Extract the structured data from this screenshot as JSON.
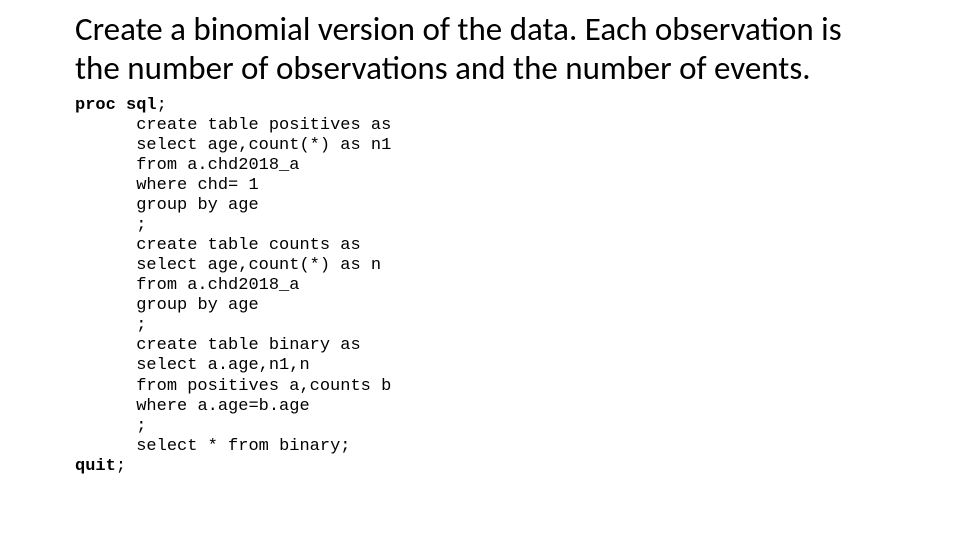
{
  "title": "Create a binomial version of the data.  Each observation is the number of observations and the number of events.",
  "code": {
    "t0": "proc",
    "t1": "sql",
    "t2": ";",
    "t3": "create",
    "t4": "table",
    "t5": "positives",
    "t6": "as",
    "t7": "select",
    "t8": "age,count(*)",
    "t9": "as",
    "t10": "n1",
    "t11": "from",
    "t12": "a.chd2018_a",
    "t13": "where",
    "t14": "chd=",
    "t15": "1",
    "t16": "group",
    "t17": "by",
    "t18": "age",
    "t19": ";",
    "t20": "create",
    "t21": "table",
    "t22": "counts",
    "t23": "as",
    "t24": "select",
    "t25": "age,count(*)",
    "t26": "as",
    "t27": "n",
    "t28": "from",
    "t29": "a.chd2018_a",
    "t30": "group",
    "t31": "by",
    "t32": "age",
    "t33": ";",
    "t34": "create",
    "t35": "table",
    "t36": "binary",
    "t37": "as",
    "t38": "select",
    "t39": "a.age,n1,n",
    "t40": "from",
    "t41": "positives a,counts b",
    "t42": "where",
    "t43": "a.age=b.age",
    "t44": ";",
    "t45": "select",
    "t46": "*",
    "t47": "from",
    "t48": "binary;",
    "t49": "quit",
    "t50": ";"
  }
}
